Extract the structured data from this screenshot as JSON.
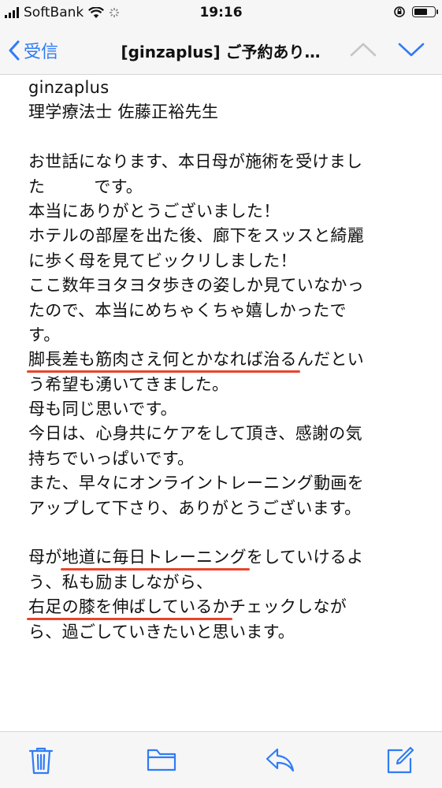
{
  "status_bar": {
    "carrier": "SoftBank",
    "time": "19:16"
  },
  "nav": {
    "back_label": "受信",
    "title": "[ginzaplus] ご予約あり…"
  },
  "mail": {
    "lines": [
      "ginzaplus",
      "理学療法士 佐藤正裕先生",
      "",
      "お世話になります、本日母が施術を受けまし",
      "です。",
      "本当にありがとうございました！",
      "ホテルの部屋を出た後、廊下をスッスと綺麗",
      "に歩く母を見てビックリしました！",
      "ここ数年ヨタヨタ歩きの姿しか見ていなかっ",
      "たので、本当にめちゃくちゃ嬉しかったで",
      "す。",
      "脚長差も筋肉さえ何とかなれば治る",
      "んだとい",
      "う希望も湧いてきました。",
      "母も同じ思いです。",
      "今日は、心身共にケアをして頂き、感謝の気",
      "持ちでいっぱいです。",
      "また、早々にオンライントレーニング動画を",
      "アップして下さり、ありがとうございます。",
      "",
      "母が",
      "地道に毎日トレーニング",
      "をしていけるよ",
      "う、私も励ましながら、",
      "右足の膝を伸ばしているか",
      "チェックしなが",
      "ら、過ごしていきたいと思います。"
    ],
    "line4_prefix": "た"
  },
  "colors": {
    "accent": "#2f7cf6",
    "underline": "#e8452c"
  },
  "icons": {
    "toolbar": [
      "trash-icon",
      "folder-icon",
      "reply-icon",
      "compose-icon"
    ]
  }
}
